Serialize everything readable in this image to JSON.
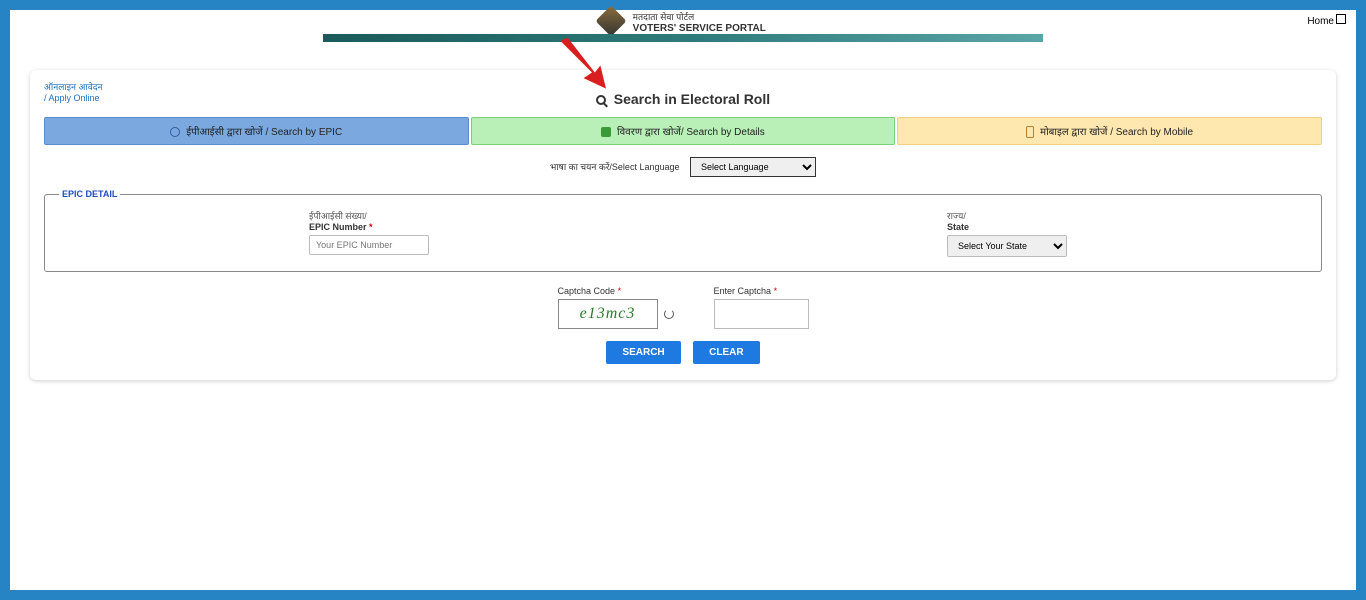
{
  "home_link": "Home",
  "header": {
    "line1": "मतदाता सेवा पोर्टल",
    "line2": "VOTERS' SERVICE PORTAL"
  },
  "breadcrumb": {
    "line1": "ऑनलाइन आवेदन",
    "line2": "/ Apply Online"
  },
  "title": "Search in Electoral Roll",
  "tabs": {
    "epic": "ईपीआईसी द्वारा खोजें / Search by EPIC",
    "details": "विवरण द्वारा खोजें/ Search by Details",
    "mobile": "मोबाइल द्वारा खोजें / Search by Mobile"
  },
  "language": {
    "label": "भाषा का चयन करें/Select Language",
    "selected": "Select Language"
  },
  "epic_detail": {
    "legend": "EPIC DETAIL",
    "epic_number": {
      "hi": "ईपीआईसी संख्या/",
      "en": "EPIC Number",
      "placeholder": "Your EPIC Number"
    },
    "state": {
      "hi": "राज्य/",
      "en": "State",
      "selected": "Select Your State"
    }
  },
  "captcha": {
    "code_label": "Captcha Code",
    "code_value": "e13mc3",
    "enter_label": "Enter Captcha"
  },
  "buttons": {
    "search": "SEARCH",
    "clear": "CLEAR"
  }
}
